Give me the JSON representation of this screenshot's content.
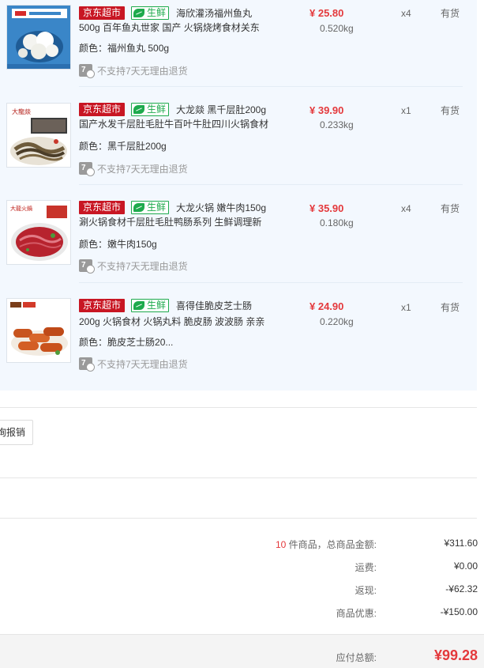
{
  "items": [
    {
      "tag_jd": "京东超市",
      "tag_fresh": "生鲜",
      "title_line1": "海欣灌汤福州鱼丸",
      "title_line2": "500g 百年鱼丸世家 国产 火锅烧烤食材关东",
      "attr_key": "颜色：",
      "attr_value": "福州鱼丸 500g",
      "policy_icon": "7",
      "policy": "不支持7天无理由退货",
      "price": "¥ 25.80",
      "weight": "0.520kg",
      "qty": "x4",
      "stock": "有货",
      "thumb_icon": "fish-ball-product-image"
    },
    {
      "tag_jd": "京东超市",
      "tag_fresh": "生鲜",
      "title_line1": "大龙燚 黑千层肚200g",
      "title_line2": "国产水发千层肚毛肚牛百叶牛肚四川火锅食材",
      "attr_key": "颜色：",
      "attr_value": "黑千层肚200g",
      "policy_icon": "7",
      "policy": "不支持7天无理由退货",
      "price": "¥ 39.90",
      "weight": "0.233kg",
      "qty": "x1",
      "stock": "有货",
      "thumb_icon": "tripe-product-image",
      "thumb_brand": "大龍燚"
    },
    {
      "tag_jd": "京东超市",
      "tag_fresh": "生鲜",
      "title_line1": "大龙火锅 嫩牛肉150g",
      "title_line2": "涮火锅食材千层肚毛肚鸭肠系列 生鲜调理新",
      "attr_key": "颜色：",
      "attr_value": "嫩牛肉150g",
      "policy_icon": "7",
      "policy": "不支持7天无理由退货",
      "price": "¥ 35.90",
      "weight": "0.180kg",
      "qty": "x4",
      "stock": "有货",
      "thumb_icon": "beef-product-image",
      "thumb_brand": "大龍火鍋"
    },
    {
      "tag_jd": "京东超市",
      "tag_fresh": "生鲜",
      "title_line1": "喜得佳脆皮芝士肠",
      "title_line2": "200g 火锅食材 火锅丸料 脆皮肠 波波肠 亲亲",
      "attr_key": "颜色：",
      "attr_value": "脆皮芝士肠20...",
      "policy_icon": "7",
      "policy": "不支持7天无理由退货",
      "price": "¥ 24.90",
      "weight": "0.220kg",
      "qty": "x1",
      "stock": "有货",
      "thumb_icon": "sausage-product-image"
    }
  ],
  "actions": {
    "reimburse_label": "询报销"
  },
  "summary": {
    "count": "10",
    "count_label": " 件商品，总商品金额:",
    "goods_total": "¥311.60",
    "shipping_label": "运费:",
    "shipping": "¥0.00",
    "cashback_label": "返现:",
    "cashback": "-¥62.32",
    "discount_label": "商品优惠:",
    "discount": "-¥150.00",
    "payable_label": "应付总额:",
    "payable": "¥99.28"
  },
  "colors": {
    "accent_red": "#e4393c",
    "jd_red": "#c81623",
    "fresh_green": "#1eaa4d",
    "panel_bg": "#f3f8fe"
  }
}
